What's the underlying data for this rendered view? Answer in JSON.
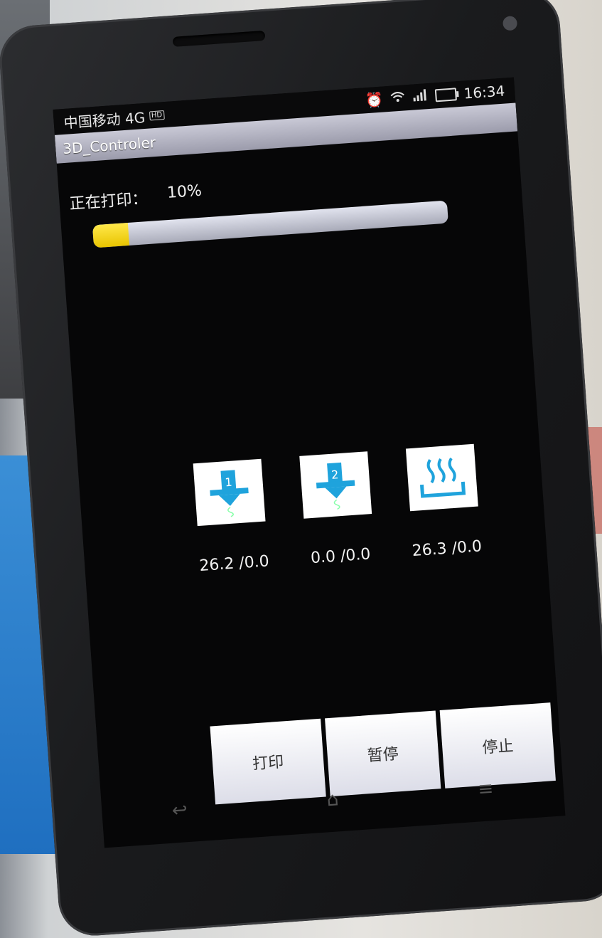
{
  "status_bar": {
    "carrier": "中国移动 4G",
    "network_badge": "HD",
    "time": "16:34",
    "icons": [
      "alarm-icon",
      "wifi-icon",
      "signal-icon",
      "battery-icon"
    ]
  },
  "app": {
    "title": "3D_Controler"
  },
  "print_status": {
    "label": "正在打印：",
    "percent_text": "10%",
    "progress_fraction": 0.1
  },
  "sensors": [
    {
      "icon": "extruder-1-icon",
      "badge": "1",
      "value": "26.2 /0.0"
    },
    {
      "icon": "extruder-2-icon",
      "badge": "2",
      "value": "0.0 /0.0"
    },
    {
      "icon": "heated-bed-icon",
      "value": "26.3 /0.0"
    }
  ],
  "controls": {
    "print_label": "打印",
    "pause_label": "暂停",
    "stop_label": "停止"
  },
  "colors": {
    "progress_fill": "#f2d31a",
    "icon_blue": "#1fa3dc",
    "title_bar": "#a9a9ba"
  }
}
